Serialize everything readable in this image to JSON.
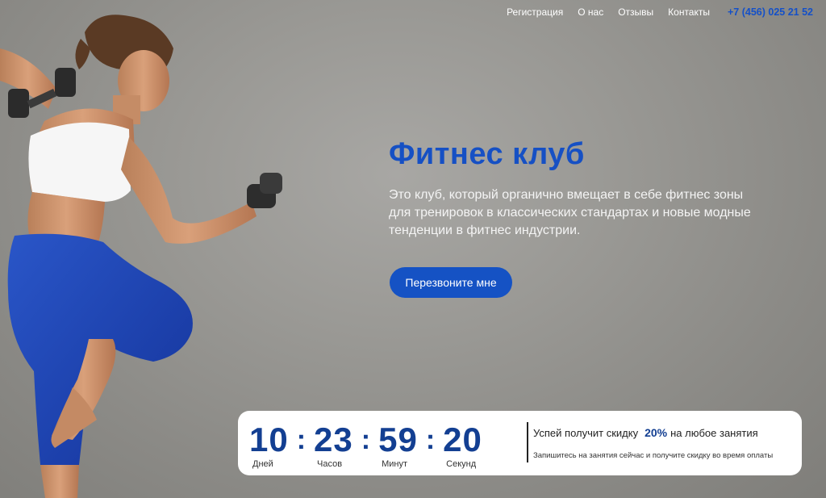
{
  "nav": {
    "items": [
      "Регистрация",
      "О нас",
      "Отзывы",
      "Контакты"
    ],
    "phone": "+7 (456) 025 21 52"
  },
  "hero": {
    "title": "Фитнес клуб",
    "description": "Это клуб, который органично вмещает в себе фитнес зоны\n для тренировок в классических стандартах и новые модные\nтенденции в фитнес индустрии.",
    "cta_label": "Перезвоните мне",
    "image": "woman-with-dumbbells"
  },
  "timer": {
    "days": "10",
    "hours": "23",
    "minutes": "59",
    "seconds": "20",
    "separator": ":",
    "days_label": "Дней",
    "hours_label": "Часов",
    "minutes_label": "Минут",
    "seconds_label": "Секунд"
  },
  "promo": {
    "text_before": "Успей получит скидку",
    "percent": "20%",
    "text_after": "на любое занятия",
    "subtext": "Запишитесь на занятия сейчас и получите скидку во время оплаты"
  },
  "colors": {
    "accent": "#1552c4",
    "timer_digits": "#133f92"
  }
}
